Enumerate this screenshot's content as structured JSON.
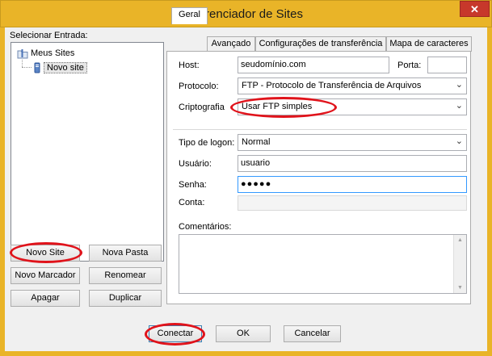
{
  "window": {
    "title": "Gerenciador de Sites",
    "close_glyph": "✕"
  },
  "left": {
    "select_label": "Selecionar Entrada:",
    "tree": {
      "root": "Meus Sites",
      "child": "Novo site"
    },
    "buttons": {
      "new_site": "Novo Site",
      "new_folder": "Nova Pasta",
      "new_bookmark": "Novo Marcador",
      "rename": "Renomear",
      "delete": "Apagar",
      "duplicate": "Duplicar"
    }
  },
  "tabs": [
    "Geral",
    "Avançado",
    "Configurações de transferência",
    "Mapa de caracteres"
  ],
  "form": {
    "host_label": "Host:",
    "host_value": "seudomínio.com",
    "port_label": "Porta:",
    "port_value": "",
    "protocol_label": "Protocolo:",
    "protocol_value": "FTP - Protocolo de Transferência de Arquivos",
    "encryption_label": "Criptografia",
    "encryption_value": "Usar FTP simples",
    "logon_label": "Tipo de logon:",
    "logon_value": "Normal",
    "user_label": "Usuário:",
    "user_value": "usuario",
    "password_label": "Senha:",
    "password_value": "●●●●●",
    "account_label": "Conta:",
    "account_value": "",
    "comments_label": "Comentários:"
  },
  "bottom": {
    "connect": "Conectar",
    "ok": "OK",
    "cancel": "Cancelar"
  },
  "colors": {
    "titlebar": "#e9b428",
    "close": "#c7382b",
    "highlight_oval": "#e0131b"
  }
}
